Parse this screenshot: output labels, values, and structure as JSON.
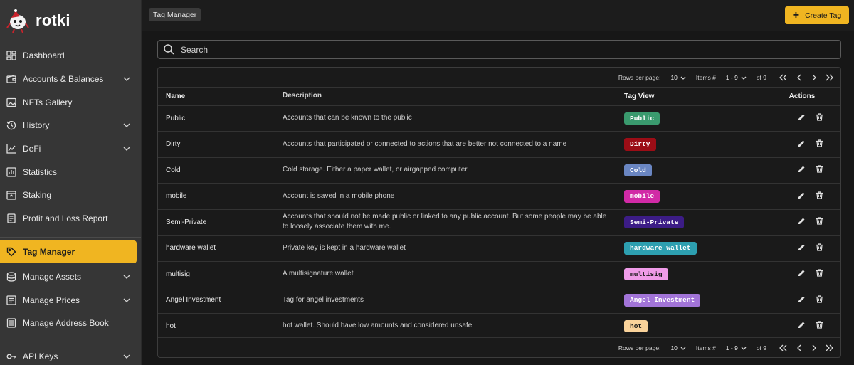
{
  "app": {
    "name": "rotki"
  },
  "sidebar": {
    "items": [
      {
        "label": "Dashboard",
        "icon": "dashboard-icon",
        "expandable": false
      },
      {
        "label": "Accounts & Balances",
        "icon": "wallet-icon",
        "expandable": true
      },
      {
        "label": "NFTs Gallery",
        "icon": "image-icon",
        "expandable": false
      },
      {
        "label": "History",
        "icon": "history-icon",
        "expandable": true
      },
      {
        "label": "DeFi",
        "icon": "line-chart-icon",
        "expandable": true
      },
      {
        "label": "Statistics",
        "icon": "bar-chart-icon",
        "expandable": false
      },
      {
        "label": "Staking",
        "icon": "staking-icon",
        "expandable": false
      },
      {
        "label": "Profit and Loss Report",
        "icon": "report-icon",
        "expandable": false
      },
      {
        "label": "Tag Manager",
        "icon": "price-tag-icon",
        "expandable": false,
        "active": true
      },
      {
        "label": "Manage Assets",
        "icon": "database-icon",
        "expandable": true
      },
      {
        "label": "Manage Prices",
        "icon": "price-list-icon",
        "expandable": true
      },
      {
        "label": "Manage Address Book",
        "icon": "address-book-icon",
        "expandable": false
      },
      {
        "label": "API Keys",
        "icon": "key-icon",
        "expandable": true
      }
    ]
  },
  "header": {
    "breadcrumb": "Tag Manager",
    "create_label": "Create Tag"
  },
  "search": {
    "placeholder": "Search"
  },
  "pagination": {
    "rows_per_page_label": "Rows per page:",
    "rows_per_page": "10",
    "items_label": "Items #",
    "range": "1 - 9",
    "of_label": "of 9"
  },
  "table": {
    "headers": {
      "name": "Name",
      "description": "Description",
      "tag_view": "Tag View",
      "actions": "Actions"
    },
    "rows": [
      {
        "name": "Public",
        "description": "Accounts that can be known to the public",
        "tag": "Public",
        "bg": "#3a9a6e",
        "fg": "#ffffff"
      },
      {
        "name": "Dirty",
        "description": "Accounts that participated or connected to actions that are better not connected to a name",
        "tag": "Dirty",
        "bg": "#9b0d16",
        "fg": "#ffffff"
      },
      {
        "name": "Cold",
        "description": "Cold storage. Either a paper wallet, or airgapped computer",
        "tag": "Cold",
        "bg": "#6a86c2",
        "fg": "#ffffff"
      },
      {
        "name": "mobile",
        "description": "Account is saved in a mobile phone",
        "tag": "mobile",
        "bg": "#d12aa6",
        "fg": "#ffffff"
      },
      {
        "name": "Semi-Private",
        "description": "Accounts that should not be made public or linked to any public account. But some people may be able to loosely associate them with me.",
        "tag": "Semi-Private",
        "bg": "#3c1c86",
        "fg": "#ffffff"
      },
      {
        "name": "hardware wallet",
        "description": "Private key is kept in a hardware wallet",
        "tag": "hardware wallet",
        "bg": "#2d9fb0",
        "fg": "#ffffff"
      },
      {
        "name": "multisig",
        "description": "A multisignature wallet",
        "tag": "multisig",
        "bg": "#ef9be8",
        "fg": "#1a1a1a"
      },
      {
        "name": "Angel Investment",
        "description": "Tag for angel investments",
        "tag": "Angel Investment",
        "bg": "#a274d8",
        "fg": "#ffffff"
      },
      {
        "name": "hot",
        "description": "hot wallet. Should have low amounts and considered unsafe",
        "tag": "hot",
        "bg": "#f9d29a",
        "fg": "#1a1a1a"
      }
    ]
  },
  "colors": {
    "accent": "#f0b521",
    "sidebar_bg": "#363636",
    "content_bg": "#171717"
  }
}
